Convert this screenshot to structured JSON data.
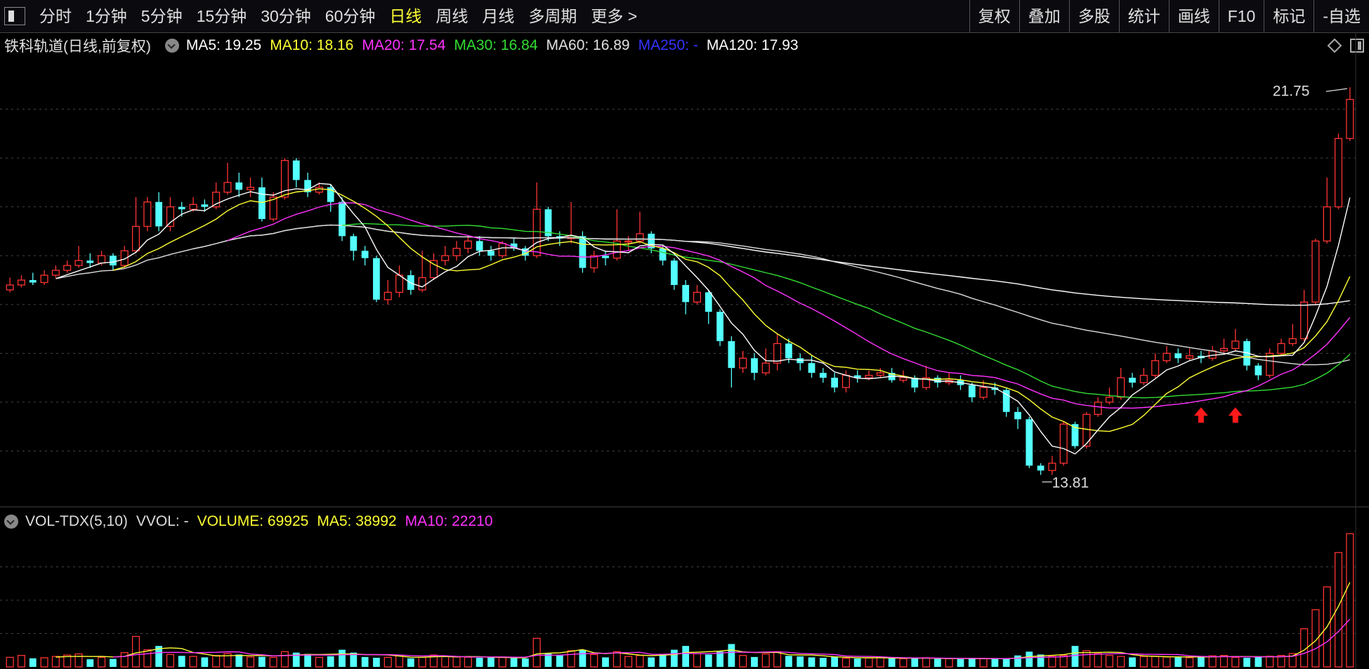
{
  "toolbar": {
    "left_items": [
      "分时",
      "1分钟",
      "5分钟",
      "15分钟",
      "30分钟",
      "60分钟",
      "日线",
      "周线",
      "月线",
      "多周期",
      "更多 >"
    ],
    "active_index": 6,
    "right_items": [
      "复权",
      "叠加",
      "多股",
      "统计",
      "画线",
      "F10",
      "标记",
      "-自选"
    ]
  },
  "main_legend": {
    "title": "铁科轨道(日线,前复权)",
    "ma": [
      {
        "label": "MA5: 19.25",
        "color": "#ffffff"
      },
      {
        "label": "MA10: 18.16",
        "color": "#ffff33"
      },
      {
        "label": "MA20: 17.54",
        "color": "#ff33ff"
      },
      {
        "label": "MA30: 16.84",
        "color": "#33dd33"
      },
      {
        "label": "MA60: 16.89",
        "color": "#e0e0e0"
      },
      {
        "label": "MA250: -",
        "color": "#3333ff"
      },
      {
        "label": "MA120: 17.93",
        "color": "#ffffff"
      }
    ]
  },
  "vol_legend": {
    "items": [
      {
        "label": "VOL-TDX(5,10)",
        "color": "#dddddd"
      },
      {
        "label": "VVOL: -",
        "color": "#dddddd"
      },
      {
        "label": "VOLUME: 69925",
        "color": "#ffff33"
      },
      {
        "label": "MA5: 38992",
        "color": "#ffff33"
      },
      {
        "label": "MA10: 22210",
        "color": "#ff33ff"
      }
    ]
  },
  "chart_data": {
    "type": "candlestick",
    "annotations": {
      "high": "21.75",
      "low": "13.81"
    },
    "colors": {
      "up": "#ff3333",
      "down": "#54ffff",
      "ma5": "#ffffff",
      "ma10": "#ffff33",
      "ma20": "#ff33ff",
      "ma30": "#33dd33",
      "ma60": "#dddddd",
      "ma120": "#ffffff"
    },
    "price_range": [
      13.3,
      22.3
    ],
    "candles": [
      [
        17.6,
        17.7,
        17.85,
        17.55
      ],
      [
        17.7,
        17.8,
        17.9,
        17.65
      ],
      [
        17.8,
        17.75,
        17.95,
        17.7
      ],
      [
        17.75,
        17.9,
        18.0,
        17.7
      ],
      [
        17.9,
        18.0,
        18.1,
        17.85
      ],
      [
        18.0,
        18.1,
        18.2,
        17.95
      ],
      [
        18.1,
        18.2,
        18.5,
        18.05
      ],
      [
        18.2,
        18.15,
        18.35,
        18.05
      ],
      [
        18.15,
        18.3,
        18.4,
        18.1
      ],
      [
        18.3,
        18.1,
        18.35,
        18.0
      ],
      [
        18.1,
        18.4,
        18.5,
        18.05
      ],
      [
        18.4,
        18.9,
        19.5,
        18.35
      ],
      [
        18.9,
        19.4,
        19.5,
        18.8
      ],
      [
        19.4,
        18.9,
        19.6,
        18.8
      ],
      [
        18.9,
        19.3,
        19.5,
        18.8
      ],
      [
        19.3,
        19.25,
        19.4,
        19.1
      ],
      [
        19.25,
        19.35,
        19.5,
        19.2
      ],
      [
        19.35,
        19.3,
        19.45,
        19.2
      ],
      [
        19.3,
        19.6,
        19.8,
        19.25
      ],
      [
        19.6,
        19.8,
        20.2,
        19.55
      ],
      [
        19.8,
        19.65,
        20.0,
        19.5
      ],
      [
        19.65,
        19.7,
        19.9,
        19.5
      ],
      [
        19.7,
        19.05,
        19.9,
        19.0
      ],
      [
        19.05,
        19.5,
        19.6,
        19.0
      ],
      [
        19.5,
        20.25,
        20.3,
        19.45
      ],
      [
        20.25,
        19.85,
        20.3,
        19.7
      ],
      [
        19.85,
        19.6,
        20.0,
        19.5
      ],
      [
        19.6,
        19.7,
        19.8,
        19.55
      ],
      [
        19.7,
        19.4,
        19.75,
        19.2
      ],
      [
        19.4,
        18.7,
        19.5,
        18.6
      ],
      [
        18.7,
        18.4,
        18.75,
        18.2
      ],
      [
        18.4,
        18.25,
        18.5,
        18.1
      ],
      [
        18.25,
        17.4,
        18.3,
        17.35
      ],
      [
        17.4,
        17.55,
        17.8,
        17.3
      ],
      [
        17.55,
        17.9,
        18.1,
        17.45
      ],
      [
        17.9,
        17.6,
        18.0,
        17.5
      ],
      [
        17.6,
        17.85,
        18.4,
        17.55
      ],
      [
        17.85,
        18.2,
        18.35,
        17.8
      ],
      [
        18.2,
        18.3,
        18.5,
        18.1
      ],
      [
        18.3,
        18.45,
        18.6,
        18.2
      ],
      [
        18.45,
        18.6,
        18.7,
        18.35
      ],
      [
        18.6,
        18.4,
        18.7,
        18.3
      ],
      [
        18.4,
        18.3,
        18.5,
        18.2
      ],
      [
        18.3,
        18.55,
        18.6,
        18.25
      ],
      [
        18.55,
        18.45,
        18.65,
        18.4
      ],
      [
        18.45,
        18.3,
        18.5,
        18.2
      ],
      [
        18.3,
        19.25,
        19.8,
        18.25
      ],
      [
        19.25,
        18.7,
        19.3,
        18.6
      ],
      [
        18.7,
        18.65,
        18.8,
        18.5
      ],
      [
        18.65,
        18.7,
        19.4,
        18.55
      ],
      [
        18.7,
        18.05,
        18.8,
        17.95
      ],
      [
        18.05,
        18.3,
        18.4,
        17.95
      ],
      [
        18.3,
        18.25,
        18.4,
        18.1
      ],
      [
        18.25,
        18.6,
        19.25,
        18.2
      ],
      [
        18.6,
        18.6,
        18.7,
        18.4
      ],
      [
        18.6,
        18.75,
        19.2,
        18.55
      ],
      [
        18.75,
        18.45,
        18.8,
        18.35
      ],
      [
        18.45,
        18.2,
        18.5,
        18.1
      ],
      [
        18.2,
        17.7,
        18.25,
        17.6
      ],
      [
        17.7,
        17.35,
        17.8,
        17.1
      ],
      [
        17.35,
        17.55,
        17.7,
        17.3
      ],
      [
        17.55,
        17.15,
        17.6,
        16.9
      ],
      [
        17.15,
        16.55,
        17.2,
        16.45
      ],
      [
        16.55,
        16.0,
        16.65,
        15.6
      ],
      [
        16.0,
        16.2,
        16.35,
        15.9
      ],
      [
        16.2,
        15.9,
        16.3,
        15.75
      ],
      [
        15.9,
        16.1,
        16.4,
        15.85
      ],
      [
        16.1,
        16.5,
        16.7,
        15.95
      ],
      [
        16.5,
        16.2,
        16.6,
        16.1
      ],
      [
        16.2,
        16.1,
        16.3,
        15.95
      ],
      [
        16.1,
        15.9,
        16.25,
        15.8
      ],
      [
        15.9,
        15.8,
        16.0,
        15.7
      ],
      [
        15.8,
        15.6,
        15.9,
        15.5
      ],
      [
        15.6,
        15.85,
        15.95,
        15.5
      ],
      [
        15.85,
        15.8,
        15.95,
        15.7
      ],
      [
        15.8,
        15.85,
        15.95,
        15.75
      ],
      [
        15.85,
        15.9,
        16.0,
        15.8
      ],
      [
        15.9,
        15.75,
        16.0,
        15.7
      ],
      [
        15.75,
        15.8,
        15.95,
        15.7
      ],
      [
        15.8,
        15.6,
        15.85,
        15.5
      ],
      [
        15.6,
        15.8,
        16.05,
        15.55
      ],
      [
        15.8,
        15.7,
        15.85,
        15.6
      ],
      [
        15.7,
        15.75,
        15.9,
        15.65
      ],
      [
        15.75,
        15.65,
        15.85,
        15.55
      ],
      [
        15.65,
        15.4,
        15.7,
        15.3
      ],
      [
        15.4,
        15.6,
        15.75,
        15.35
      ],
      [
        15.6,
        15.55,
        15.7,
        15.45
      ],
      [
        15.55,
        15.1,
        15.6,
        15.0
      ],
      [
        15.1,
        14.95,
        15.2,
        14.75
      ],
      [
        14.95,
        14.0,
        15.0,
        13.95
      ],
      [
        14.0,
        13.9,
        14.05,
        13.81
      ],
      [
        13.9,
        14.05,
        14.2,
        13.81
      ],
      [
        14.05,
        14.85,
        14.9,
        14.0
      ],
      [
        14.85,
        14.4,
        14.9,
        14.35
      ],
      [
        14.4,
        15.05,
        15.1,
        14.35
      ],
      [
        15.05,
        15.3,
        15.4,
        15.0
      ],
      [
        15.3,
        15.4,
        15.6,
        15.25
      ],
      [
        15.4,
        15.8,
        16.0,
        15.35
      ],
      [
        15.8,
        15.7,
        15.9,
        15.6
      ],
      [
        15.7,
        15.85,
        16.0,
        15.65
      ],
      [
        15.85,
        16.15,
        16.3,
        15.8
      ],
      [
        16.15,
        16.3,
        16.45,
        16.1
      ],
      [
        16.3,
        16.2,
        16.4,
        16.1
      ],
      [
        16.2,
        16.25,
        16.4,
        16.15
      ],
      [
        16.25,
        16.2,
        16.35,
        16.1
      ],
      [
        16.2,
        16.35,
        16.45,
        16.15
      ],
      [
        16.35,
        16.4,
        16.6,
        16.3
      ],
      [
        16.4,
        16.55,
        16.8,
        16.35
      ],
      [
        16.55,
        16.05,
        16.6,
        15.95
      ],
      [
        16.05,
        15.85,
        16.1,
        15.75
      ],
      [
        15.85,
        16.3,
        16.4,
        15.8
      ],
      [
        16.3,
        16.5,
        16.6,
        16.25
      ],
      [
        16.5,
        16.6,
        16.9,
        16.45
      ],
      [
        16.6,
        17.35,
        17.6,
        16.55
      ],
      [
        17.35,
        18.6,
        18.65,
        17.3
      ],
      [
        18.6,
        19.3,
        19.9,
        18.55
      ],
      [
        19.3,
        20.7,
        20.8,
        19.25
      ],
      [
        20.7,
        21.5,
        21.75,
        20.65
      ]
    ],
    "volume_range": [
      0,
      70000
    ],
    "volumes": [
      5000,
      6000,
      4500,
      4800,
      5500,
      6200,
      6800,
      4000,
      5000,
      4200,
      7500,
      16000,
      9000,
      11000,
      6500,
      5800,
      5500,
      5000,
      6000,
      7000,
      6500,
      5200,
      5300,
      5000,
      8000,
      7500,
      6800,
      5000,
      5600,
      9000,
      7500,
      5200,
      4800,
      5000,
      6000,
      4500,
      5000,
      6200,
      5500,
      5200,
      5100,
      4800,
      4900,
      5000,
      4600,
      4400,
      15000,
      7000,
      6000,
      8500,
      9000,
      6500,
      5000,
      8000,
      5500,
      6000,
      5000,
      6500,
      9000,
      11000,
      7000,
      6500,
      8000,
      12000,
      6000,
      5200,
      6800,
      8000,
      5800,
      5500,
      5000,
      4800,
      5500,
      4500,
      4400,
      4700,
      5000,
      4600,
      4300,
      4500,
      4800,
      4200,
      4300,
      4100,
      4500,
      4400,
      4300,
      4200,
      6000,
      8000,
      6500,
      5500,
      6000,
      11000,
      8500,
      7000,
      6000,
      5500,
      5000,
      5500,
      5600,
      5200,
      5000,
      4800,
      5500,
      5800,
      6000,
      5000,
      4800,
      5200,
      5600,
      6000,
      7000,
      20000,
      30000,
      42000,
      60000,
      69925
    ]
  }
}
